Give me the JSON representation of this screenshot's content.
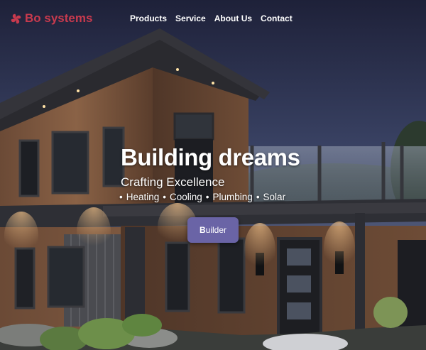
{
  "brand": {
    "name": "Bo systems",
    "icon": "pinwheel-logo-icon",
    "color": "#c83a4e"
  },
  "nav": {
    "items": [
      {
        "label": "Products"
      },
      {
        "label": "Service"
      },
      {
        "label": "About Us"
      },
      {
        "label": "Contact"
      }
    ]
  },
  "hero": {
    "headline": "Building dreams",
    "subheadline": "Crafting Excellence",
    "services": [
      "Heating",
      "Cooling",
      "Plumbing",
      "Solar"
    ],
    "cta": {
      "initial": "B",
      "rest": "uilder",
      "color": "#6a64a6"
    }
  }
}
